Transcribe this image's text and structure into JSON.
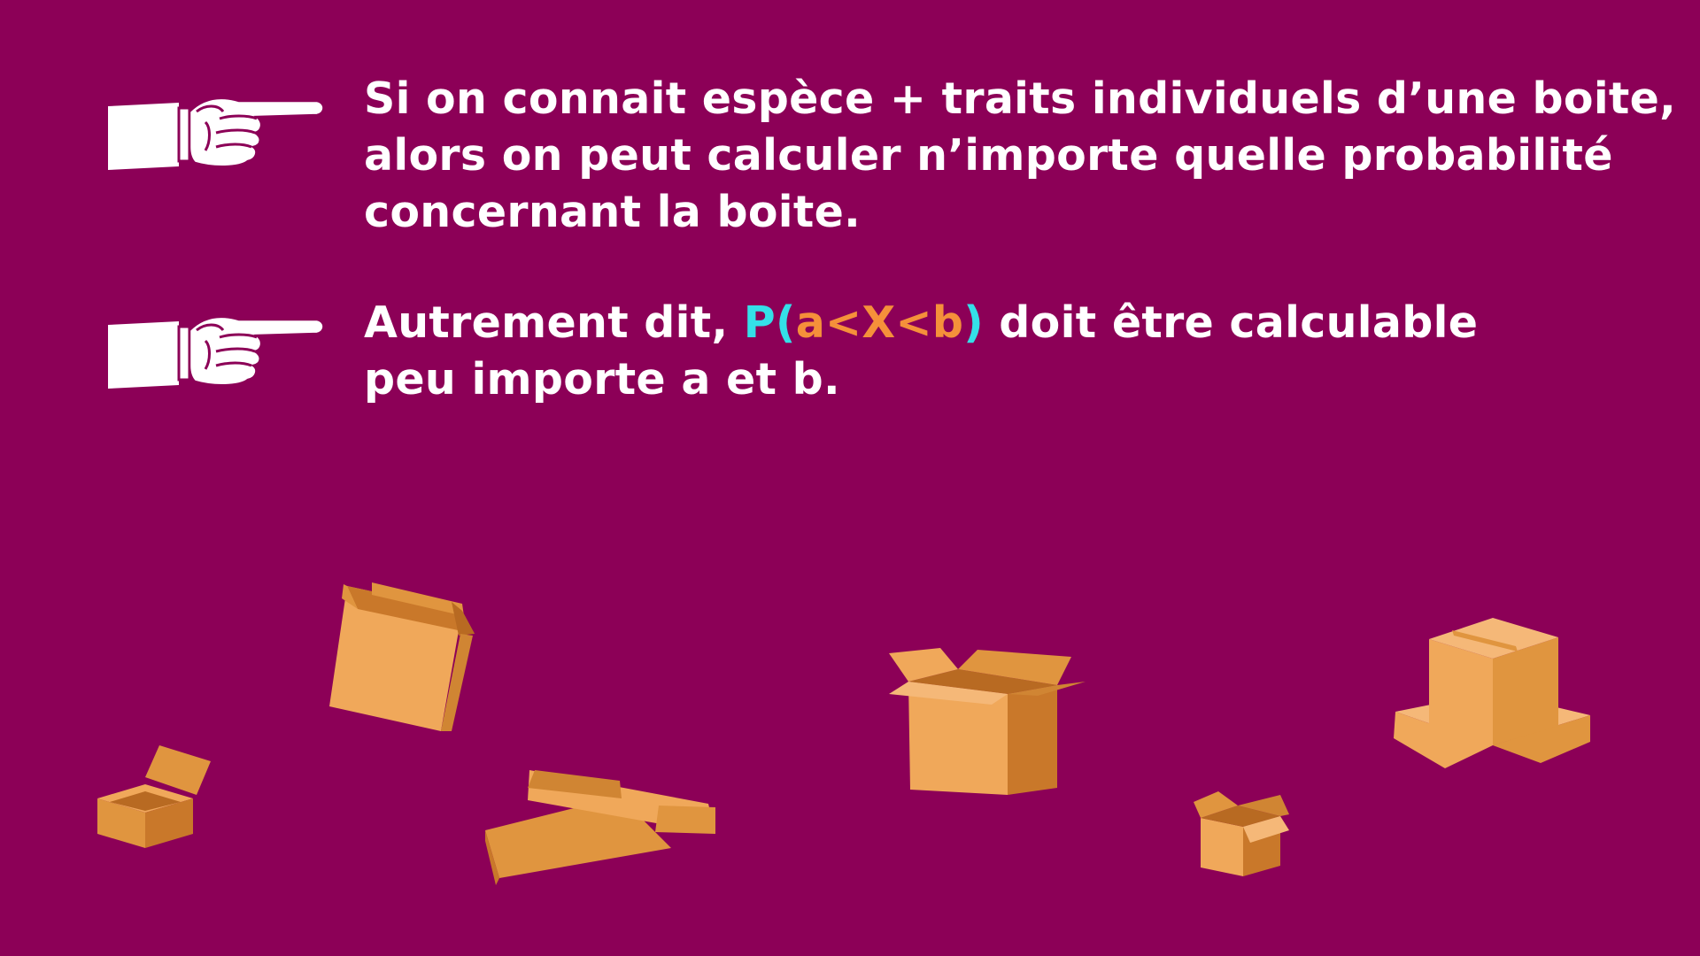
{
  "bullets": [
    {
      "icon": "pointing-hand-icon",
      "lines": [
        "Si on connait espèce + traits individuels d’une boite,",
        "alors on peut calculer n’importe quelle probabilité",
        "concernant la boite."
      ]
    },
    {
      "icon": "pointing-hand-icon",
      "line1_prefix": "Autrement dit, ",
      "formula": {
        "p_open": "P(",
        "a_lt_x_lt_b": "a<X<b",
        "close": ")"
      },
      "line1_suffix": " doit être calculable",
      "line2": "peu importe a et b."
    }
  ],
  "colors": {
    "background": "#8c0057",
    "text": "#ffffff",
    "formula_cyan": "#34e0e8",
    "formula_orange": "#f5903a",
    "box_light": "#f0a85a",
    "box_mid": "#e0953f",
    "box_dark": "#c9782a"
  },
  "decorations": [
    "cardboard-box-icon",
    "cardboard-box-icon",
    "cardboard-box-icon",
    "cardboard-box-icon",
    "cardboard-box-icon",
    "cardboard-box-icon"
  ]
}
